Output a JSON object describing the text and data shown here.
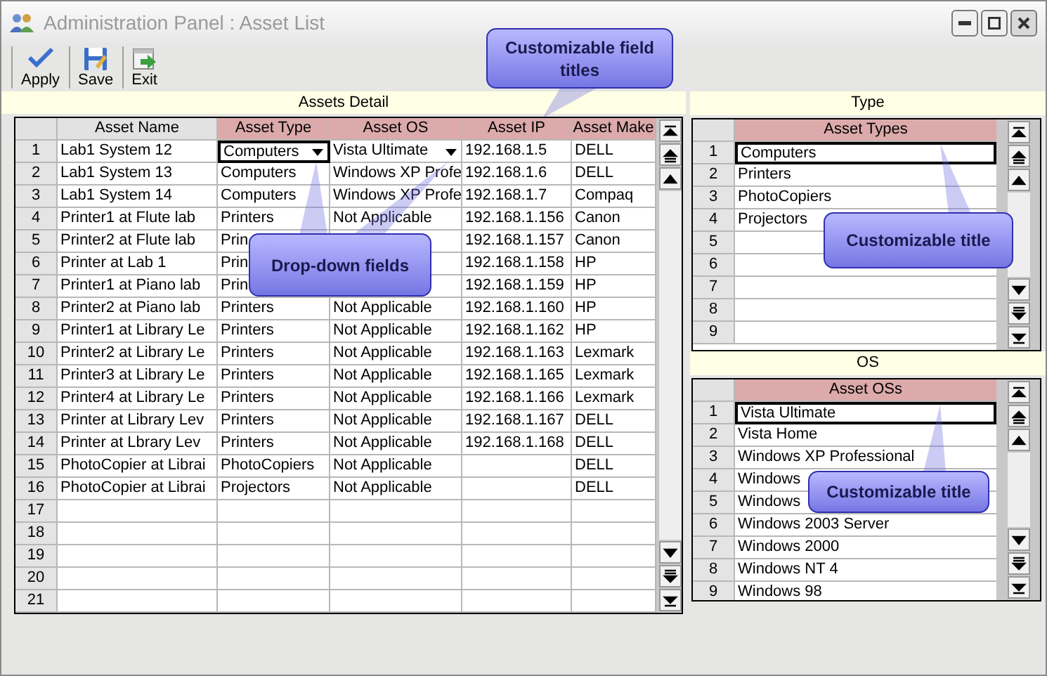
{
  "window": {
    "title": "Administration Panel : Asset List"
  },
  "toolbar": [
    {
      "kind": "apply",
      "label": "Apply"
    },
    {
      "kind": "save",
      "label": "Save"
    },
    {
      "kind": "exit",
      "label": "Exit"
    }
  ],
  "assets_detail": {
    "title": "Assets Detail",
    "columns": [
      {
        "label": "Asset Name",
        "highlighted": false
      },
      {
        "label": "Asset Type",
        "highlighted": true
      },
      {
        "label": "Asset OS",
        "highlighted": true
      },
      {
        "label": "Asset IP",
        "highlighted": true
      },
      {
        "label": "Asset Make",
        "highlighted": true
      }
    ],
    "rows": [
      {
        "number": "1",
        "selected": true,
        "asset_name": "Lab1 System 12",
        "asset_type": "Computers",
        "asset_os": "Vista Ultimate",
        "asset_ip": "192.168.1.5",
        "asset_make": "DELL"
      },
      {
        "number": "2",
        "selected": false,
        "asset_name": "Lab1 System 13",
        "asset_type": "Computers",
        "asset_os": "Windows XP Profe",
        "asset_ip": "192.168.1.6",
        "asset_make": "DELL"
      },
      {
        "number": "3",
        "selected": false,
        "asset_name": "Lab1 System 14",
        "asset_type": "Computers",
        "asset_os": "Windows XP Profe",
        "asset_ip": "192.168.1.7",
        "asset_make": "Compaq"
      },
      {
        "number": "4",
        "selected": false,
        "asset_name": "Printer1 at Flute lab",
        "asset_type": "Printers",
        "asset_os": "Not Applicable",
        "asset_ip": "192.168.1.156",
        "asset_make": "Canon"
      },
      {
        "number": "5",
        "selected": false,
        "asset_name": "Printer2 at Flute lab",
        "asset_type": "Prin",
        "asset_ip": "192.168.1.157",
        "asset_make": "Canon"
      },
      {
        "number": "6",
        "selected": false,
        "asset_name": "Printer at Lab 1",
        "asset_type": "Prin",
        "asset_ip": "192.168.1.158",
        "asset_make": "HP"
      },
      {
        "number": "7",
        "selected": false,
        "asset_name": "Printer1 at Piano lab",
        "asset_type": "Prin",
        "asset_ip": "192.168.1.159",
        "asset_make": "HP"
      },
      {
        "number": "8",
        "selected": false,
        "asset_name": "Printer2 at Piano lab",
        "asset_type": "Printers",
        "asset_os": "Not Applicable",
        "asset_ip": "192.168.1.160",
        "asset_make": "HP"
      },
      {
        "number": "9",
        "selected": false,
        "asset_name": "Printer1 at Library Le",
        "asset_type": "Printers",
        "asset_os": "Not Applicable",
        "asset_ip": "192.168.1.162",
        "asset_make": "HP"
      },
      {
        "number": "10",
        "selected": false,
        "asset_name": "Printer2 at Library Le",
        "asset_type": "Printers",
        "asset_os": "Not Applicable",
        "asset_ip": "192.168.1.163",
        "asset_make": "Lexmark"
      },
      {
        "number": "11",
        "selected": false,
        "asset_name": "Printer3 at Library Le",
        "asset_type": "Printers",
        "asset_os": "Not Applicable",
        "asset_ip": "192.168.1.165",
        "asset_make": "Lexmark"
      },
      {
        "number": "12",
        "selected": false,
        "asset_name": "Printer4 at Library Le",
        "asset_type": "Printers",
        "asset_os": "Not Applicable",
        "asset_ip": "192.168.1.166",
        "asset_make": "Lexmark"
      },
      {
        "number": "13",
        "selected": false,
        "asset_name": "Printer at Library Lev",
        "asset_type": "Printers",
        "asset_os": "Not Applicable",
        "asset_ip": "192.168.1.167",
        "asset_make": "DELL"
      },
      {
        "number": "14",
        "selected": false,
        "asset_name": "Printer at Lbrary Lev",
        "asset_type": "Printers",
        "asset_os": "Not Applicable",
        "asset_ip": "192.168.1.168",
        "asset_make": "DELL"
      },
      {
        "number": "15",
        "selected": false,
        "asset_name": "PhotoCopier at Librai",
        "asset_type": "PhotoCopiers",
        "asset_os": "Not Applicable",
        "asset_make": "DELL"
      },
      {
        "number": "16",
        "selected": false,
        "asset_name": "PhotoCopier at Librai",
        "asset_type": "Projectors",
        "asset_os": "Not Applicable",
        "asset_make": "DELL"
      },
      {
        "number": "17",
        "selected": false
      },
      {
        "number": "18",
        "selected": false
      },
      {
        "number": "19",
        "selected": false
      },
      {
        "number": "20",
        "selected": false
      },
      {
        "number": "21",
        "selected": false
      }
    ]
  },
  "type_panel": {
    "title": "Type",
    "column": {
      "label": "Asset Types",
      "highlighted": true
    },
    "rows": [
      {
        "number": "1",
        "value": "Computers",
        "selected": true
      },
      {
        "number": "2",
        "value": "Printers",
        "selected": false
      },
      {
        "number": "3",
        "value": "PhotoCopiers",
        "selected": false
      },
      {
        "number": "4",
        "value": "Projectors",
        "selected": false
      },
      {
        "number": "5",
        "selected": false
      },
      {
        "number": "6",
        "selected": false
      },
      {
        "number": "7",
        "selected": false
      },
      {
        "number": "8",
        "selected": false
      },
      {
        "number": "9",
        "selected": false
      }
    ]
  },
  "os_panel": {
    "title": "OS",
    "column": {
      "label": "Asset OSs",
      "highlighted": true
    },
    "rows": [
      {
        "number": "1",
        "value": "Vista Ultimate",
        "selected": true
      },
      {
        "number": "2",
        "value": "Vista Home",
        "selected": false
      },
      {
        "number": "3",
        "value": "Windows XP Professional",
        "selected": false
      },
      {
        "number": "4",
        "value": "Windows",
        "selected": false
      },
      {
        "number": "5",
        "value": "Windows",
        "selected": false
      },
      {
        "number": "6",
        "value": "Windows 2003 Server",
        "selected": false
      },
      {
        "number": "7",
        "value": "Windows 2000",
        "selected": false
      },
      {
        "number": "8",
        "value": "Windows NT 4",
        "selected": false
      },
      {
        "number": "9",
        "value": "Windows 98",
        "selected": false
      }
    ]
  },
  "callouts": [
    {
      "text": "Customizable field titles"
    },
    {
      "text": "Drop-down fields"
    },
    {
      "text": "Customizable title"
    },
    {
      "text": "Customizable title"
    }
  ]
}
